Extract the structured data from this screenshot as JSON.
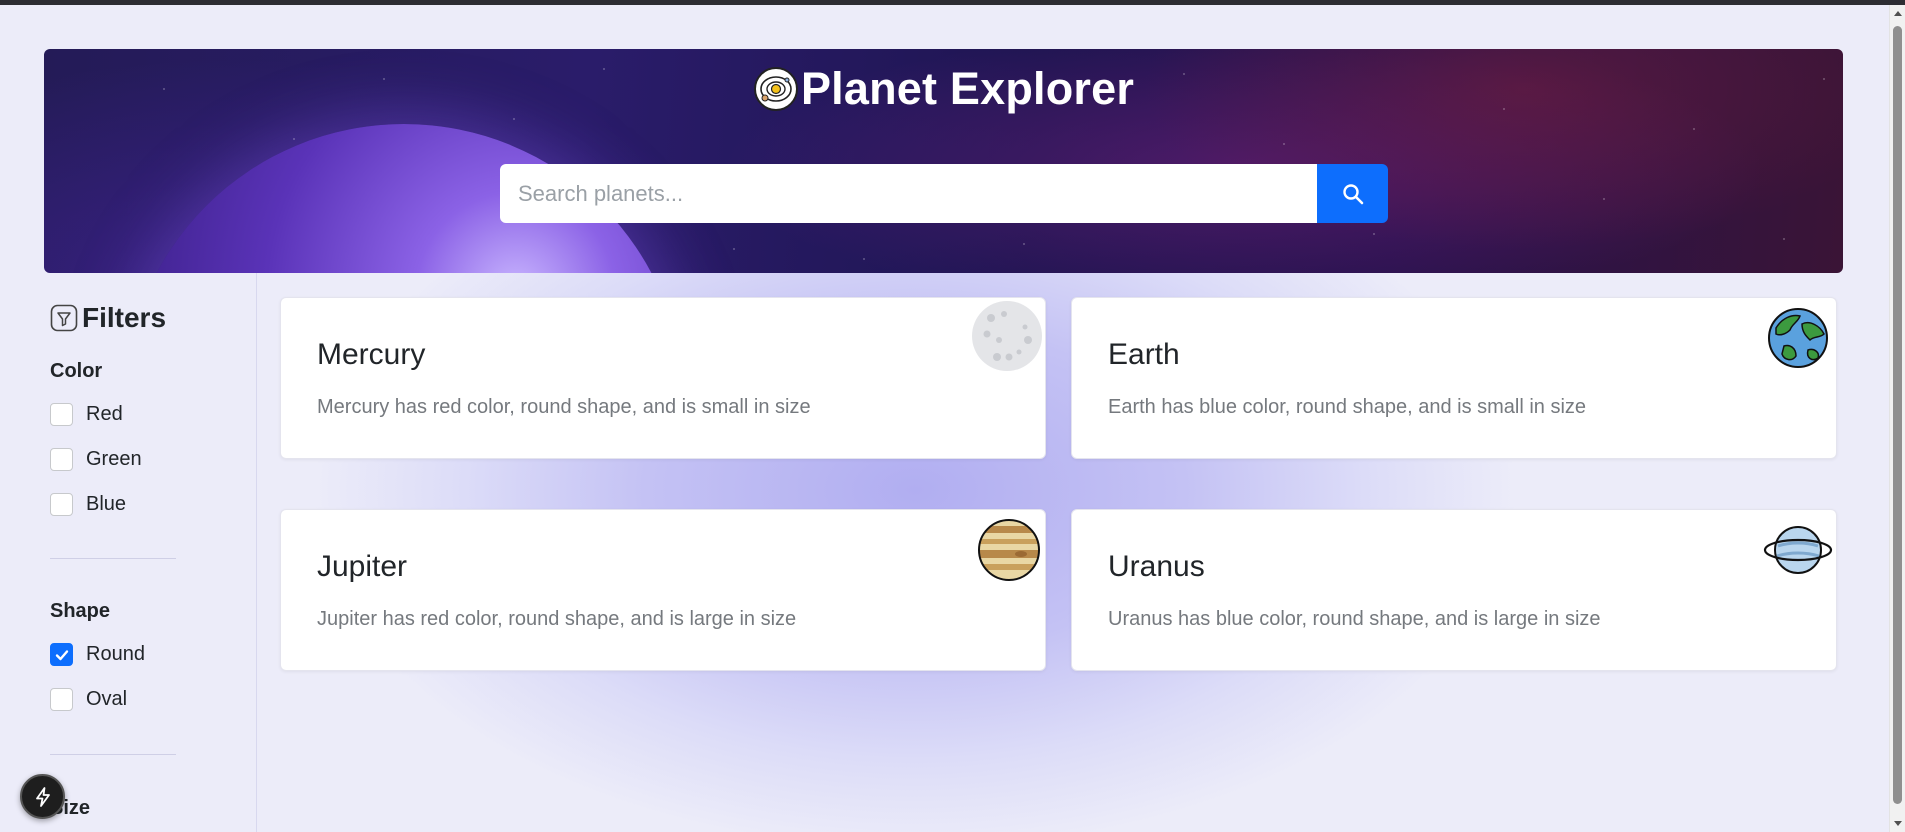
{
  "header": {
    "title": "Planet Explorer",
    "logo_icon": "solar-system-icon",
    "search_placeholder": "Search planets...",
    "search_value": "",
    "search_button_icon": "search-icon"
  },
  "sidebar": {
    "title": "Filters",
    "title_icon": "filter-icon",
    "groups": [
      {
        "title": "Color",
        "options": [
          {
            "label": "Red",
            "checked": false
          },
          {
            "label": "Green",
            "checked": false
          },
          {
            "label": "Blue",
            "checked": false
          }
        ]
      },
      {
        "title": "Shape",
        "options": [
          {
            "label": "Round",
            "checked": true
          },
          {
            "label": "Oval",
            "checked": false
          }
        ]
      },
      {
        "title": "Size",
        "options": []
      }
    ]
  },
  "planets": [
    {
      "name": "Mercury",
      "description": "Mercury has red color, round shape, and is small in size",
      "icon": "mercury-icon"
    },
    {
      "name": "Earth",
      "description": "Earth has blue color, round shape, and is small in size",
      "icon": "earth-icon"
    },
    {
      "name": "Jupiter",
      "description": "Jupiter has red color, round shape, and is large in size",
      "icon": "jupiter-icon"
    },
    {
      "name": "Uranus",
      "description": "Uranus has blue color, round shape, and is large in size",
      "icon": "uranus-icon"
    }
  ],
  "floating_button": {
    "icon": "lightning-icon"
  },
  "colors": {
    "accent": "#0d6efd",
    "hero_dark": "#241b57"
  }
}
